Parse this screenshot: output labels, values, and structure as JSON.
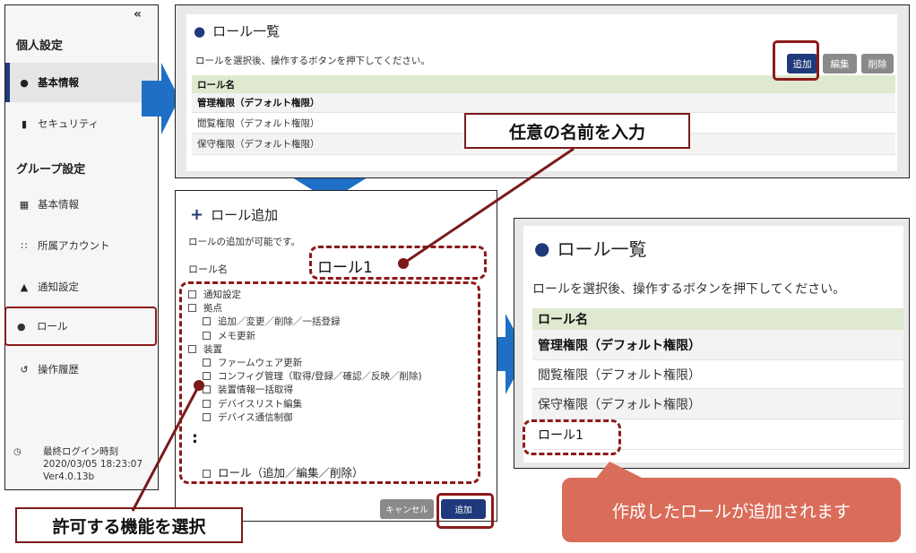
{
  "sidebar": {
    "collapse_glyph": "«",
    "personal_heading": "個人設定",
    "personal_items": [
      {
        "label": "基本情報",
        "icon": "user-icon"
      },
      {
        "label": "セキュリティ",
        "icon": "lock-icon"
      }
    ],
    "group_heading": "グループ設定",
    "group_items": [
      {
        "label": "基本情報",
        "icon": "building-icon"
      },
      {
        "label": "所属アカウント",
        "icon": "users-icon"
      },
      {
        "label": "通知設定",
        "icon": "bell-icon"
      },
      {
        "label": "ロール",
        "icon": "user-key-icon"
      },
      {
        "label": "操作履歴",
        "icon": "history-icon"
      }
    ],
    "footer": {
      "label": "最終ログイン時刻",
      "datetime": "2020/03/05 18:23:07",
      "version": "Ver4.0.13b"
    }
  },
  "role_list": {
    "title": "ロール一覧",
    "description": "ロールを選択後、操作するボタンを押下してください。",
    "buttons": {
      "add": "追加",
      "edit": "編集",
      "delete": "削除"
    },
    "column_header": "ロール名",
    "rows": [
      "管理権限（デフォルト権限）",
      "閲覧権限（デフォルト権限）",
      "保守権限（デフォルト権限）"
    ]
  },
  "role_add": {
    "title": "ロール追加",
    "description": "ロールの追加が可能です。",
    "name_label": "ロール名",
    "name_value": "ロール1",
    "permissions": [
      {
        "label": "通知設定",
        "level": 0
      },
      {
        "label": "拠点",
        "level": 0
      },
      {
        "label": "追加／変更／削除／一括登録",
        "level": 1
      },
      {
        "label": "メモ更新",
        "level": 1
      },
      {
        "label": "装置",
        "level": 0
      },
      {
        "label": "ファームウェア更新",
        "level": 1
      },
      {
        "label": "コンフィグ管理（取得/登録／確認／反映／削除)",
        "level": 1
      },
      {
        "label": "装置情報一括取得",
        "level": 1
      },
      {
        "label": "デバイスリスト編集",
        "level": 1
      },
      {
        "label": "デバイス通信制御",
        "level": 1
      }
    ],
    "ellipsis": ":",
    "last_permission": "ロール（追加／編集／削除）",
    "buttons": {
      "cancel": "キャンセル",
      "add": "追加"
    }
  },
  "role_list_result": {
    "title": "ロール一覧",
    "description": "ロールを選択後、操作するボタンを押下してください。",
    "column_header": "ロール名",
    "rows": [
      "管理権限（デフォルト権限）",
      "閲覧権限（デフォルト権限）",
      "保守権限（デフォルト権限）",
      "ロール1"
    ]
  },
  "annotations": {
    "enter_name": "任意の名前を入力",
    "select_functions": "許可する機能を選択",
    "result": "作成したロールが追加されます"
  },
  "colors": {
    "accent_navy": "#1f3a7a",
    "arrow_blue": "#1e6fc5",
    "highlight_red": "#8b1a1a",
    "table_header_green": "#dfe9cf",
    "result_callout": "#d96d5a"
  }
}
